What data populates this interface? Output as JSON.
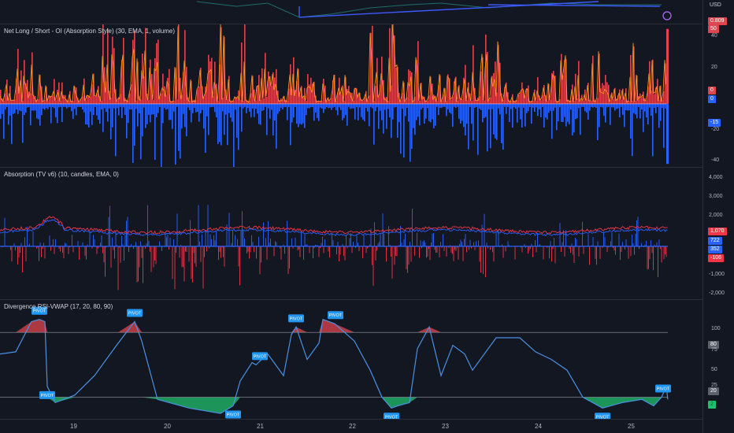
{
  "currency": "USD",
  "price_badge": "0.809",
  "chart_data": [
    {
      "type": "bar",
      "title": "Net Long / Short - OI (Absorption Style) (30, EMA, 1, volume)",
      "ylim": [
        -42,
        53
      ],
      "y_ticks": [
        40,
        20,
        -20,
        -40
      ],
      "last_values": {
        "overlay": "50",
        "zero_a": "0",
        "zero_b": "0",
        "net": "-15"
      },
      "colors": {
        "long": "#e0444e",
        "short": "#2962ff",
        "ema": "#f7931a"
      }
    },
    {
      "type": "line",
      "title": "Absorption (TV v6) (10, candles, EMA, 0)",
      "ylim": [
        -2300,
        4300
      ],
      "y_ticks": [
        "4,000",
        "3,000",
        "2,000",
        "-1,000",
        "-2,000"
      ],
      "last_values": {
        "red_line": "1,070",
        "blue_line": "722",
        "center": "352",
        "delta": "-106"
      },
      "colors": {
        "red": "#f23645",
        "blue": "#2962ff"
      }
    },
    {
      "type": "line",
      "title": "Divergence RSI-VWAP (17, 20, 80, 90)",
      "ylim": [
        0,
        110
      ],
      "y_ticks": [
        "100",
        "75",
        "50",
        "25"
      ],
      "thresholds": {
        "upper": "80",
        "lower": "20"
      },
      "last_value": "2",
      "pivot_label": "PIVOT",
      "colors": {
        "line": "#4a90e2",
        "above": "#e0444e",
        "below": "#21c06e",
        "pivot": "#2196f3"
      },
      "series": [
        {
          "x": [
            0,
            20,
            40,
            50,
            57,
            60,
            70,
            95,
            120,
            150,
            171,
            180,
            200,
            240,
            280,
            296,
            305,
            320,
            325,
            340,
            360,
            370,
            376,
            390,
            405,
            410,
            425,
            450,
            470,
            485,
            497,
            505,
            520,
            530,
            545,
            560,
            575,
            590,
            600,
            630,
            660,
            680,
            700,
            720,
            740,
            765,
            790,
            815,
            830,
            840,
            846,
            848
          ],
          "y": [
            60,
            62,
            90,
            92,
            90,
            30,
            15,
            22,
            40,
            70,
            90,
            72,
            18,
            10,
            5,
            12,
            35,
            52,
            50,
            60,
            40,
            78,
            85,
            55,
            70,
            92,
            88,
            72,
            45,
            20,
            10,
            12,
            15,
            65,
            85,
            40,
            68,
            60,
            45,
            75,
            75,
            62,
            55,
            45,
            20,
            10,
            15,
            18,
            12,
            20,
            30,
            18
          ]
        }
      ],
      "pivots": [
        {
          "x": 50,
          "pos": "top"
        },
        {
          "x": 171,
          "pos": "top"
        },
        {
          "x": 330,
          "pos": "top"
        },
        {
          "x": 376,
          "pos": "top"
        },
        {
          "x": 426,
          "pos": "top"
        },
        {
          "x": 842,
          "pos": "top"
        },
        {
          "x": 60,
          "pos": "bottom"
        },
        {
          "x": 296,
          "pos": "bottom"
        },
        {
          "x": 497,
          "pos": "bottom"
        },
        {
          "x": 765,
          "pos": "bottom"
        }
      ]
    }
  ],
  "x_axis": [
    "19",
    "20",
    "21",
    "22",
    "23",
    "24",
    "25"
  ]
}
